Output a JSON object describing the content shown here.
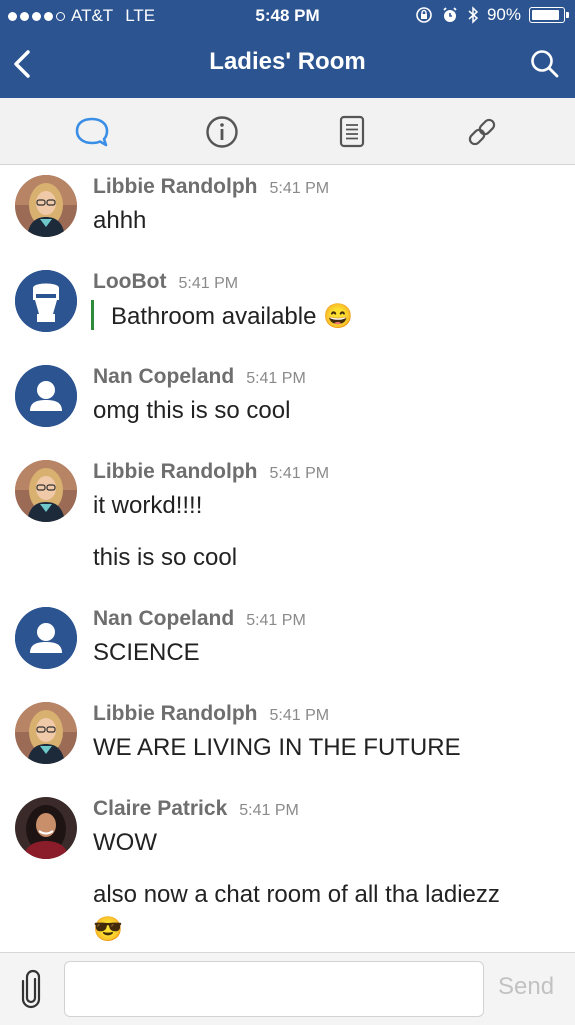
{
  "status_bar": {
    "carrier": "AT&T",
    "network": "LTE",
    "time": "5:48 PM",
    "battery": "90%",
    "battery_level": 0.9
  },
  "nav": {
    "title": "Ladies' Room",
    "back_icon": "chevron-left-icon",
    "search_icon": "search-icon"
  },
  "tabs": [
    {
      "icon": "chat-bubble-icon",
      "active": true
    },
    {
      "icon": "info-icon",
      "active": false
    },
    {
      "icon": "document-icon",
      "active": false
    },
    {
      "icon": "link-icon",
      "active": false
    }
  ],
  "messages": [
    {
      "author": "Libbie Randolph",
      "time": "5:41 PM",
      "lines": [
        "ahhh"
      ]
    },
    {
      "author": "LooBot",
      "time": "5:41 PM",
      "lines": [
        "Bathroom available 😄"
      ],
      "quoted": true
    },
    {
      "author": "Nan Copeland",
      "time": "5:41 PM",
      "lines": [
        "omg this is so cool"
      ]
    },
    {
      "author": "Libbie Randolph",
      "time": "5:41 PM",
      "lines": [
        "it workd!!!!",
        "this is so cool"
      ]
    },
    {
      "author": "Nan Copeland",
      "time": "5:41 PM",
      "lines": [
        "SCIENCE"
      ]
    },
    {
      "author": "Libbie Randolph",
      "time": "5:41 PM",
      "lines": [
        "WE ARE LIVING IN THE FUTURE"
      ]
    },
    {
      "author": "Claire Patrick",
      "time": "5:41 PM",
      "lines": [
        "WOW",
        "also now a chat room of all tha ladiezz",
        "😎"
      ]
    }
  ],
  "composer": {
    "placeholder": "",
    "send_label": "Send",
    "attach_icon": "paperclip-icon"
  },
  "colors": {
    "header": "#2c5491",
    "active_tab": "#3a8ee6",
    "quote_bar": "#2e8b3a"
  }
}
